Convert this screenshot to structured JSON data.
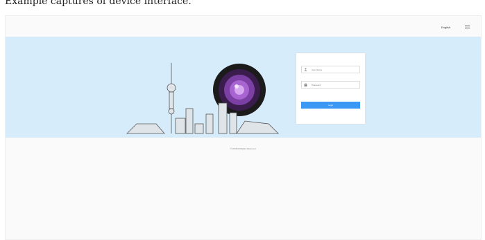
{
  "caption": "Example captures of device interface.",
  "header": {
    "language": "English"
  },
  "login": {
    "username_placeholder": "User Name",
    "password_placeholder": "Password",
    "login_label": "Login"
  },
  "footer": {
    "copyright": "© 2018 All Rights Reserved."
  },
  "colors": {
    "banner": "#d6ecfb",
    "login_button": "#3a97f4",
    "page_background": "#fafafa"
  },
  "icons": [
    "menu-icon",
    "user-icon",
    "lock-icon",
    "camera-lens-illustration",
    "city-skyline-illustration"
  ]
}
